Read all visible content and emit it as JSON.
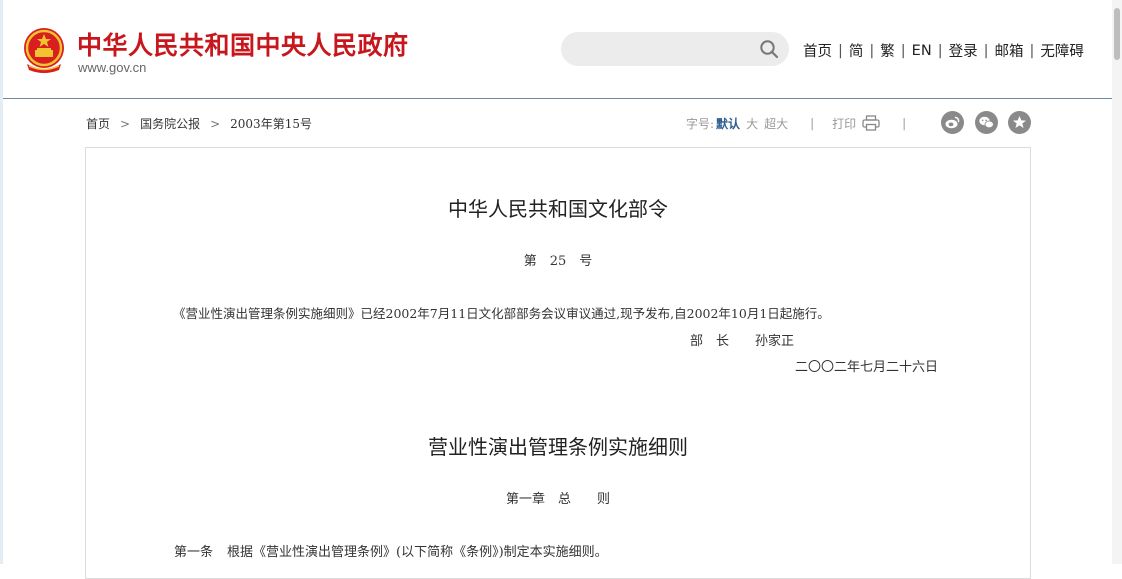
{
  "header": {
    "site_title": "中华人民共和国中央人民政府",
    "site_url": "www.gov.cn",
    "search": {
      "value": "",
      "placeholder": ""
    },
    "nav": [
      "首页",
      "简",
      "繁",
      "EN",
      "登录",
      "邮箱",
      "无障碍"
    ]
  },
  "breadcrumb": {
    "items": [
      "首页",
      "国务院公报",
      "2003年第15号"
    ]
  },
  "tools": {
    "font_label": "字号:",
    "font_default": "默认",
    "font_large": "大",
    "font_xlarge": "超大",
    "print_label": "打印"
  },
  "document": {
    "title": "中华人民共和国文化部令",
    "order_number": "第　25　号",
    "notice": "《营业性演出管理条例实施细则》已经2002年7月11日文化部部务会议审议通过,现予发布,自2002年10月1日起施行。",
    "signer": "部　长　　孙家正",
    "date": "二〇〇二年七月二十六日",
    "rules_title": "营业性演出管理条例实施细则",
    "chapter": "第一章　总　　则",
    "article_number": "第一条",
    "article_text": "根据《营业性演出管理条例》(以下简称《条例》)制定本实施细则。"
  },
  "colors": {
    "brand_red": "#c8161d",
    "share_icon_gray": "#8a8a8a",
    "active_blue": "#2f5e8e"
  }
}
